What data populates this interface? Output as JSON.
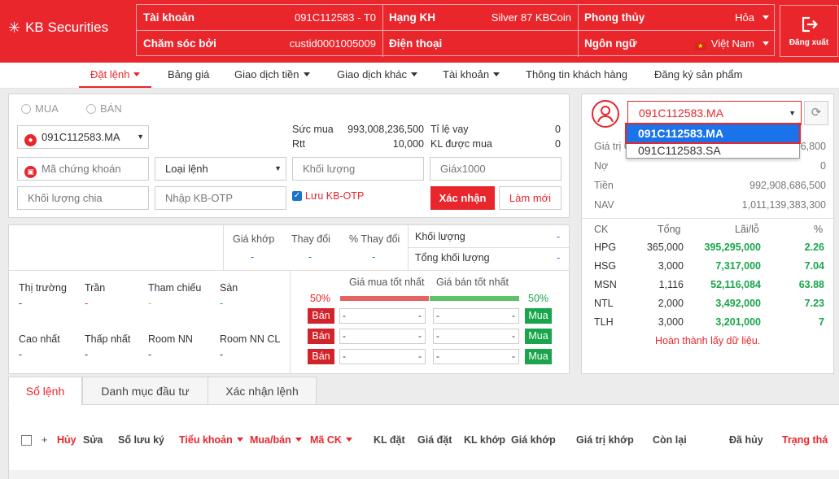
{
  "brand": {
    "name": "KB Securities"
  },
  "account": {
    "account_label": "Tài khoản",
    "account_value": "091C112583 - T0",
    "care_label": "Chăm sóc bởi",
    "care_value": "custid0001005009",
    "rank_label": "Hạng KH",
    "rank_value": "Silver 87 KBCoin",
    "phone_label": "Điện thoại",
    "phone_value": "",
    "theme_label": "Phong thủy",
    "theme_value": "Hỏa",
    "lang_label": "Ngôn ngữ",
    "lang_value": "Việt Nam",
    "logout_label": "Đăng xuất"
  },
  "nav": [
    "Đặt lệnh",
    "Bảng giá",
    "Giao dịch tiền",
    "Giao dịch khác",
    "Tài khoản",
    "Thông tin khách hàng",
    "Đăng ký sản phẩm"
  ],
  "order": {
    "buy_label": "MUA",
    "sell_label": "BÁN",
    "sub_account": "091C112583.MA",
    "buying_power_label": "Sức mua",
    "buying_power_value": "993,008,236,500",
    "rtt_label": "Rtt",
    "rtt_value": "10,000",
    "loan_ratio_label": "Tỉ lệ vay",
    "loan_ratio_value": "0",
    "kl_buy_label": "KL được mua",
    "kl_buy_value": "0",
    "symbol_placeholder": "Mã chứng khoán",
    "order_type_placeholder": "Loại lệnh",
    "volume_placeholder": "Khối lượng",
    "price_placeholder": "Giáx1000",
    "split_placeholder": "Khối lượng chia",
    "otp_placeholder": "Nhập KB-OTP",
    "save_otp_label": "Lưu KB-OTP",
    "confirm_label": "Xác nhận",
    "reset_label": "Làm mới"
  },
  "quote": {
    "match_price_label": "Giá khớp",
    "change_label": "Thay đổi",
    "pct_change_label": "% Thay đổi",
    "match_price": "-",
    "change": "-",
    "pct_change": "-",
    "volume_label": "Khối lượng",
    "volume": "-",
    "total_volume_label": "Tổng khối lượng",
    "total_volume": "-",
    "market_label": "Thị trường",
    "ceiling_label": "Trần",
    "ref_label": "Tham chiếu",
    "floor_label": "Sàn",
    "market": "-",
    "ceiling": "-",
    "ref": "-",
    "floor": "-",
    "high_label": "Cao nhất",
    "low_label": "Thấp nhất",
    "room_label": "Room NN",
    "room_cl_label": "Room NN CL",
    "high": "-",
    "low": "-",
    "room": "-",
    "room_cl": "-",
    "best_buy_label": "Giá mua tốt nhất",
    "best_sell_label": "Giá bán tốt nhất",
    "buy_pct": "50%",
    "sell_pct": "50%",
    "sell_btn": "Bán",
    "buy_btn": "Mua",
    "book": [
      {
        "bid": "-",
        "bid_vol": "-",
        "ask": "-",
        "ask_vol": "-"
      },
      {
        "bid": "-",
        "bid_vol": "-",
        "ask": "-",
        "ask_vol": "-"
      },
      {
        "bid": "-",
        "bid_vol": "-",
        "ask": "-",
        "ask_vol": "-"
      }
    ]
  },
  "portfolio": {
    "selected": "091C112583.MA",
    "options": [
      "091C112583.MA",
      "091C112583.SA"
    ],
    "value_label": "Giá trị C",
    "value_value": "6,800",
    "debt_label": "Nợ",
    "debt_value": "0",
    "cash_label": "Tiền",
    "cash_value": "992,908,686,500",
    "nav_label": "NAV",
    "nav_value": "1,011,139,383,300",
    "col_ck": "CK",
    "col_total": "Tổng",
    "col_pl": "Lãi/lỗ",
    "col_pct": "%",
    "rows": [
      {
        "ck": "HPG",
        "total": "365,000",
        "pl": "395,295,000",
        "pct": "2.26"
      },
      {
        "ck": "HSG",
        "total": "3,000",
        "pl": "7,317,000",
        "pct": "7.04"
      },
      {
        "ck": "MSN",
        "total": "1,116",
        "pl": "52,116,084",
        "pct": "63.88"
      },
      {
        "ck": "NTL",
        "total": "2,000",
        "pl": "3,492,000",
        "pct": "7.23"
      },
      {
        "ck": "TLH",
        "total": "3,000",
        "pl": "3,201,000",
        "pct": "7"
      }
    ],
    "status": "Hoàn thành lấy dữ liệu."
  },
  "bottom": {
    "tabs": [
      "Sổ lệnh",
      "Danh mục đầu tư",
      "Xác nhận lệnh"
    ],
    "plus": "+",
    "cols": [
      "Hủy",
      "Sửa",
      "Số lưu ký",
      "Tiểu khoản",
      "Mua/bán",
      "Mã CK",
      "KL đặt",
      "Giá đặt",
      "KL khớp",
      "Giá khớp",
      "Giá trị khớp",
      "Còn lại",
      "Đã hủy",
      "Trạng thá"
    ]
  },
  "colors": {
    "brand": "#e8262c",
    "green": "#19a54a",
    "orange": "#f5a623",
    "blue": "#1a73c9"
  }
}
